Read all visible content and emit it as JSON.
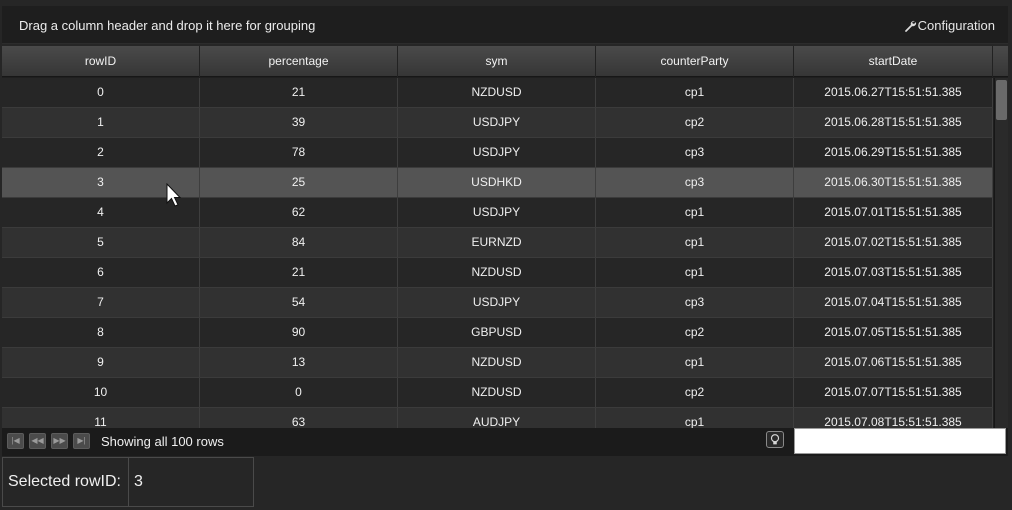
{
  "group_bar": {
    "hint": "Drag a column header and drop it here for grouping",
    "config_label": "Configuration",
    "config_icon": "wrench-icon"
  },
  "grid": {
    "columns": [
      "rowID",
      "percentage",
      "sym",
      "counterParty",
      "startDate"
    ],
    "selected_row_index": 3,
    "rows": [
      [
        "0",
        "21",
        "NZDUSD",
        "cp1",
        "2015.06.27T15:51:51.385"
      ],
      [
        "1",
        "39",
        "USDJPY",
        "cp2",
        "2015.06.28T15:51:51.385"
      ],
      [
        "2",
        "78",
        "USDJPY",
        "cp3",
        "2015.06.29T15:51:51.385"
      ],
      [
        "3",
        "25",
        "USDHKD",
        "cp3",
        "2015.06.30T15:51:51.385"
      ],
      [
        "4",
        "62",
        "USDJPY",
        "cp1",
        "2015.07.01T15:51:51.385"
      ],
      [
        "5",
        "84",
        "EURNZD",
        "cp1",
        "2015.07.02T15:51:51.385"
      ],
      [
        "6",
        "21",
        "NZDUSD",
        "cp1",
        "2015.07.03T15:51:51.385"
      ],
      [
        "7",
        "54",
        "USDJPY",
        "cp3",
        "2015.07.04T15:51:51.385"
      ],
      [
        "8",
        "90",
        "GBPUSD",
        "cp2",
        "2015.07.05T15:51:51.385"
      ],
      [
        "9",
        "13",
        "NZDUSD",
        "cp1",
        "2015.07.06T15:51:51.385"
      ],
      [
        "10",
        "0",
        "NZDUSD",
        "cp2",
        "2015.07.07T15:51:51.385"
      ],
      [
        "11",
        "63",
        "AUDJPY",
        "cp1",
        "2015.07.08T15:51:51.385"
      ]
    ]
  },
  "footer": {
    "status": "Showing all 100 rows",
    "pager_icons": [
      "first-page-icon",
      "prev-page-icon",
      "next-page-icon",
      "last-page-icon"
    ],
    "search_value": ""
  },
  "selection": {
    "label": "Selected rowID:",
    "value": "3"
  }
}
